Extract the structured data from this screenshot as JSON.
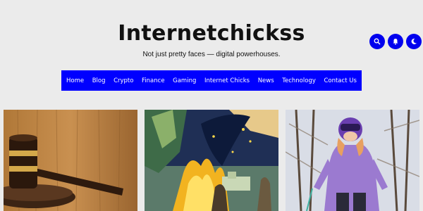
{
  "header": {
    "site_title": "Internetchickss",
    "tagline": "Not just pretty faces — digital powerhouses."
  },
  "header_icons": [
    {
      "icon": "search-icon"
    },
    {
      "icon": "bell-icon"
    },
    {
      "icon": "moon-icon"
    }
  ],
  "nav": {
    "items": [
      {
        "label": "Home"
      },
      {
        "label": "Blog"
      },
      {
        "label": "Crypto"
      },
      {
        "label": "Finance"
      },
      {
        "label": "Gaming"
      },
      {
        "label": "Internet Chicks"
      },
      {
        "label": "News"
      },
      {
        "label": "Technology"
      },
      {
        "label": "Contact Us"
      }
    ]
  },
  "colors": {
    "accent": "#0000ff",
    "background": "#ebebeb",
    "text": "#111111"
  },
  "posts": [
    {
      "image": "gavel-image"
    },
    {
      "image": "bonfire-illustration-image"
    },
    {
      "image": "girl-skiing-image"
    }
  ]
}
